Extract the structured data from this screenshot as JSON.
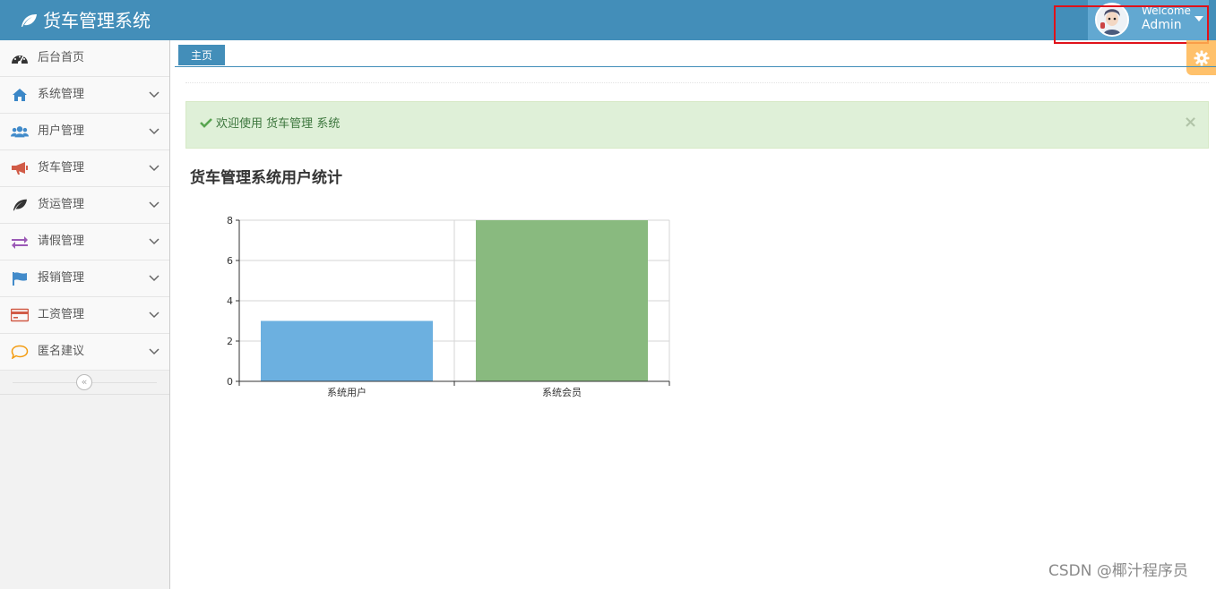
{
  "app": {
    "title": "货车管理系统",
    "user": {
      "welcome": "Welcome",
      "name": "Admin"
    }
  },
  "sidebar": {
    "items": [
      {
        "label": "后台首页",
        "icon": "tachometer-icon",
        "color": "#333333",
        "has_arrow": false
      },
      {
        "label": "系统管理",
        "icon": "home-icon",
        "color": "#3b87c7",
        "has_arrow": true
      },
      {
        "label": "用户管理",
        "icon": "users-icon",
        "color": "#428bca",
        "has_arrow": true
      },
      {
        "label": "货车管理",
        "icon": "bullhorn-icon",
        "color": "#d15b47",
        "has_arrow": true
      },
      {
        "label": "货运管理",
        "icon": "leaf-icon",
        "color": "#333333",
        "has_arrow": true
      },
      {
        "label": "请假管理",
        "icon": "exchange-icon",
        "color": "#9b59b6",
        "has_arrow": true
      },
      {
        "label": "报销管理",
        "icon": "flag-icon",
        "color": "#428bca",
        "has_arrow": true
      },
      {
        "label": "工资管理",
        "icon": "credit-card-icon",
        "color": "#d15b47",
        "has_arrow": true
      },
      {
        "label": "匿名建议",
        "icon": "comment-icon",
        "color": "#f39c12",
        "has_arrow": true
      }
    ],
    "collapse_glyph": "«"
  },
  "tabs": [
    {
      "label": "主页"
    }
  ],
  "alert": {
    "prefix": "欢迎使用",
    "app_name": "货车管理",
    "suffix": "系统",
    "close": "×"
  },
  "chart_title": "货车管理系统用户统计",
  "chart_data": {
    "type": "bar",
    "categories": [
      "系统用户",
      "系统会员"
    ],
    "values": [
      3,
      8
    ],
    "colors": [
      "#6cb0e0",
      "#89ba7f"
    ],
    "ylim": [
      0,
      8
    ],
    "yticks": [
      0,
      2,
      4,
      6,
      8
    ],
    "grid": true
  },
  "watermark": "CSDN @椰汁程序员",
  "colors": {
    "navbar": "#438eb9",
    "accent": "#62a8d1",
    "alert_bg": "#dff0d8",
    "alert_text": "#3c763d",
    "highlight": "#e0121a"
  }
}
